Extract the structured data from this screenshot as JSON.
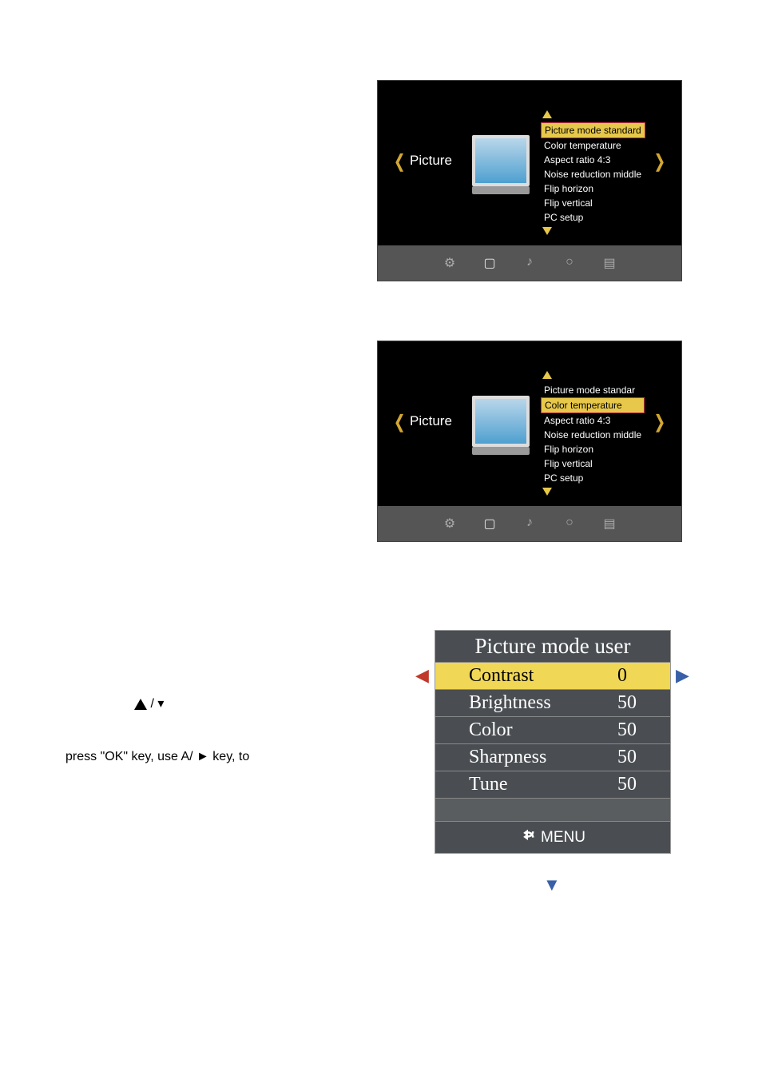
{
  "doc": {
    "tri_line_text": " / ▾",
    "ok_line": "press \"OK\" key, use A/ ► key, to"
  },
  "osd1": {
    "category": "Picture",
    "selectedIndex": 0,
    "items": [
      "Picture mode standard",
      "Color temperature",
      "Aspect ratio 4:3",
      "Noise reduction middle",
      "Flip horizon",
      "Flip vertical",
      "PC setup"
    ]
  },
  "osd2": {
    "category": "Picture",
    "selectedIndex": 1,
    "items": [
      "Picture mode standar",
      "Color temperature",
      "Aspect ratio 4:3",
      "Noise reduction middle",
      "Flip horizon",
      "Flip vertical",
      "PC setup"
    ]
  },
  "pmu": {
    "title": "Picture mode user",
    "rows": [
      {
        "label": "Contrast",
        "value": "0"
      },
      {
        "label": "Brightness",
        "value": "50"
      },
      {
        "label": "Color",
        "value": "50"
      },
      {
        "label": "Sharpness",
        "value": "50"
      },
      {
        "label": "Tune",
        "value": "50"
      }
    ],
    "menu": "MENU"
  }
}
